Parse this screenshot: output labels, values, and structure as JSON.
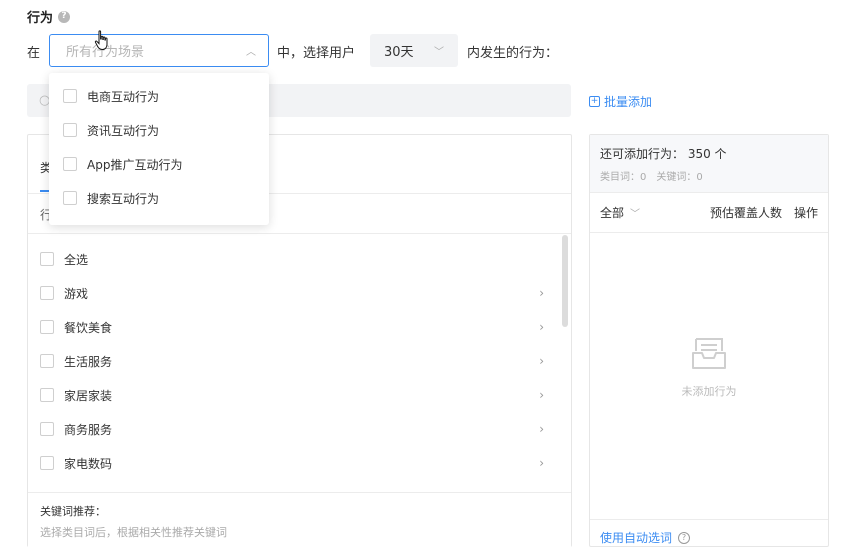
{
  "header": {
    "title": "行为",
    "help_icon": "?"
  },
  "filter": {
    "prefix": "在",
    "scene_placeholder": "所有行为场景",
    "middle": "中，选择用户",
    "days_value": "30天",
    "suffix": "内发生的行为："
  },
  "scene_dropdown": {
    "options": [
      "电商互动行为",
      "资讯互动行为",
      "App推广互动行为",
      "搜索互动行为"
    ]
  },
  "batch_add": "批量添加",
  "left_panel": {
    "tab_label": "类",
    "subhead_label": "行",
    "categories": [
      {
        "label": "全选",
        "has_arrow": false
      },
      {
        "label": "游戏",
        "has_arrow": true
      },
      {
        "label": "餐饮美食",
        "has_arrow": true
      },
      {
        "label": "生活服务",
        "has_arrow": true
      },
      {
        "label": "家居家装",
        "has_arrow": true
      },
      {
        "label": "商务服务",
        "has_arrow": true
      },
      {
        "label": "家电数码",
        "has_arrow": true
      }
    ],
    "keyword_title": "关键词推荐：",
    "keyword_hint": "选择类目词后，根据相关性推荐关键词"
  },
  "right_panel": {
    "remaining": "还可添加行为： 350 个",
    "category_count": "类目词：0",
    "keyword_count": "关键词：0",
    "col_all": "全部",
    "col_cover": "预估覆盖人数",
    "col_op": "操作",
    "empty_text": "未添加行为",
    "auto_select": "使用自动选词"
  },
  "colors": {
    "accent": "#3b8cf2"
  }
}
